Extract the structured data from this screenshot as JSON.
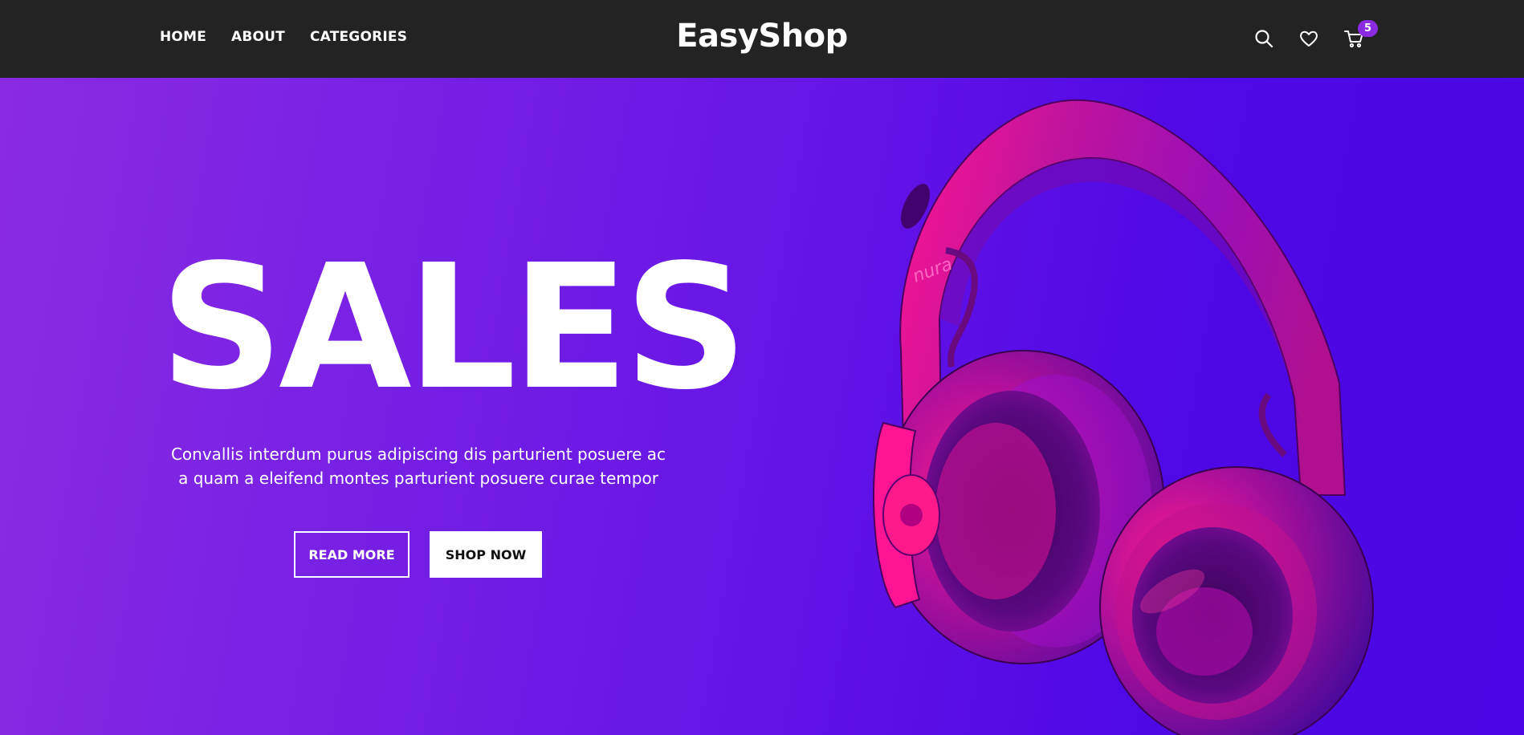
{
  "nav": {
    "links": [
      "HOME",
      "ABOUT",
      "CATEGORIES"
    ],
    "brand": "EasyShop",
    "icons": [
      "search-icon",
      "heart-icon",
      "cart-icon"
    ],
    "cart_count": "5"
  },
  "hero": {
    "title": "SALES",
    "description": "Convallis interdum purus adipiscing dis parturient posuere ac a quam a eleifend montes parturient posuere curae tempor",
    "read_more_label": "READ MORE",
    "shop_now_label": "SHOP NOW",
    "product_brand": "nura"
  },
  "colors": {
    "navbar": "#232323",
    "hero_gradient_start": "#8a2be2",
    "hero_gradient_end": "#4a06e4",
    "badge": "#8a2be2",
    "headphone_pink": "#ff1493"
  }
}
